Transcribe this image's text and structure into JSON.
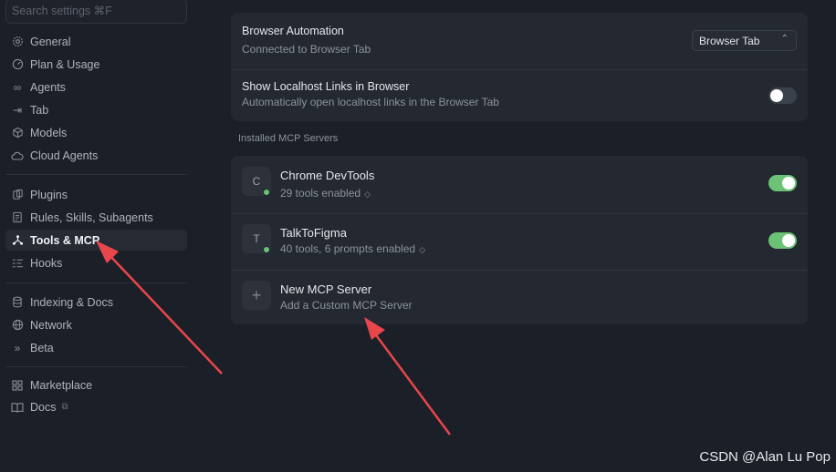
{
  "search": {
    "placeholder": "Search settings ⌘F"
  },
  "sidebar": {
    "items": [
      {
        "label": "General",
        "icon": "gear-icon"
      },
      {
        "label": "Plan & Usage",
        "icon": "gauge-icon"
      },
      {
        "label": "Agents",
        "icon": "infinity-icon"
      },
      {
        "label": "Tab",
        "icon": "tab-arrow-icon"
      },
      {
        "label": "Models",
        "icon": "cube-icon"
      },
      {
        "label": "Cloud Agents",
        "icon": "cloud-icon"
      },
      {
        "label": "Plugins",
        "icon": "puzzle-icon"
      },
      {
        "label": "Rules, Skills, Subagents",
        "icon": "document-icon"
      },
      {
        "label": "Tools & MCP",
        "icon": "nodes-icon"
      },
      {
        "label": "Hooks",
        "icon": "hooks-icon"
      },
      {
        "label": "Indexing & Docs",
        "icon": "database-icon"
      },
      {
        "label": "Network",
        "icon": "globe-icon"
      },
      {
        "label": "Beta",
        "icon": "double-chevron-icon"
      },
      {
        "label": "Marketplace",
        "icon": "grid-icon"
      },
      {
        "label": "Docs",
        "icon": "book-icon"
      }
    ],
    "active": "Tools & MCP"
  },
  "browser_automation": {
    "title": "Browser Automation",
    "subtitle": "Connected to Browser Tab",
    "select_value": "Browser Tab"
  },
  "localhost_links": {
    "title": "Show Localhost Links in Browser",
    "subtitle": "Automatically open localhost links in the Browser Tab",
    "enabled": false
  },
  "mcp": {
    "section_label": "Installed MCP Servers",
    "servers": [
      {
        "initial": "C",
        "name": "Chrome DevTools",
        "detail": "29 tools enabled",
        "enabled": true,
        "status": "connected"
      },
      {
        "initial": "T",
        "name": "TalkToFigma",
        "detail": "40 tools, 6 prompts enabled",
        "enabled": true,
        "status": "connected"
      }
    ],
    "new_server": {
      "title": "New MCP Server",
      "subtitle": "Add a Custom MCP Server"
    }
  },
  "colors": {
    "background": "#1b1f27",
    "card": "#232831",
    "toggle_on": "#6cc378",
    "annotation_arrow": "#e8464a"
  },
  "watermark": "CSDN @Alan Lu Pop"
}
